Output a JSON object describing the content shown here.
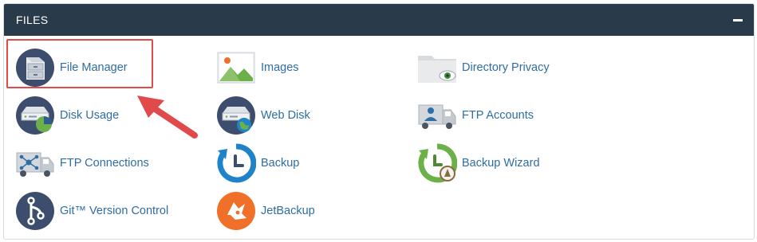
{
  "panel": {
    "title": "FILES",
    "collapse_glyph": "minus"
  },
  "items": [
    {
      "label": "File Manager",
      "icon": "file-cabinet-icon"
    },
    {
      "label": "Images",
      "icon": "image-landscape-icon"
    },
    {
      "label": "Directory Privacy",
      "icon": "folder-eye-icon"
    },
    {
      "label": "Disk Usage",
      "icon": "disk-usage-icon"
    },
    {
      "label": "Web Disk",
      "icon": "web-disk-icon"
    },
    {
      "label": "FTP Accounts",
      "icon": "ftp-accounts-icon"
    },
    {
      "label": "FTP Connections",
      "icon": "ftp-connections-icon"
    },
    {
      "label": "Backup",
      "icon": "backup-icon"
    },
    {
      "label": "Backup Wizard",
      "icon": "backup-wizard-icon"
    },
    {
      "label": "Git™ Version Control",
      "icon": "git-icon"
    },
    {
      "label": "JetBackup",
      "icon": "jetbackup-icon"
    }
  ],
  "colors": {
    "header": "#293a4a",
    "link": "#2e6da4",
    "highlight": "#e14a4a",
    "icon_navy": "#3c4d6e",
    "icon_blue": "#1f83c9",
    "icon_green": "#6cb04a",
    "icon_orange": "#f0702a"
  }
}
